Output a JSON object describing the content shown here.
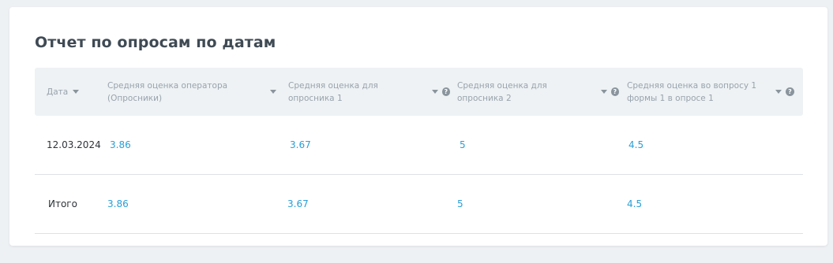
{
  "report": {
    "title": "Отчет по опросам по датам",
    "columns": [
      {
        "label": "Дата",
        "has_help": false
      },
      {
        "label": "Средняя оценка оператора (Опросники)",
        "has_help": false
      },
      {
        "label": "Средняя оценка для опросника 1",
        "has_help": true
      },
      {
        "label": "Средняя оценка для опросника 2",
        "has_help": true
      },
      {
        "label": "Средняя оценка во вопросу 1 формы 1 в опросе 1",
        "has_help": true
      }
    ],
    "rows": [
      {
        "date": "12.03.2024",
        "operator": "3.86",
        "q1": "3.67",
        "q2": "5",
        "q3": "4.5"
      }
    ],
    "total": {
      "label": "Итого",
      "operator": "3.86",
      "q1": "3.67",
      "q2": "5",
      "q3": "4.5"
    }
  },
  "icons": {
    "sort": "caret-down-icon",
    "help": "question-circle-icon"
  },
  "help_glyph": "?",
  "colors": {
    "link": "#2a9fd6",
    "header_bg": "#eef2f4",
    "header_text": "#98a3ad",
    "title": "#3f4a54"
  }
}
